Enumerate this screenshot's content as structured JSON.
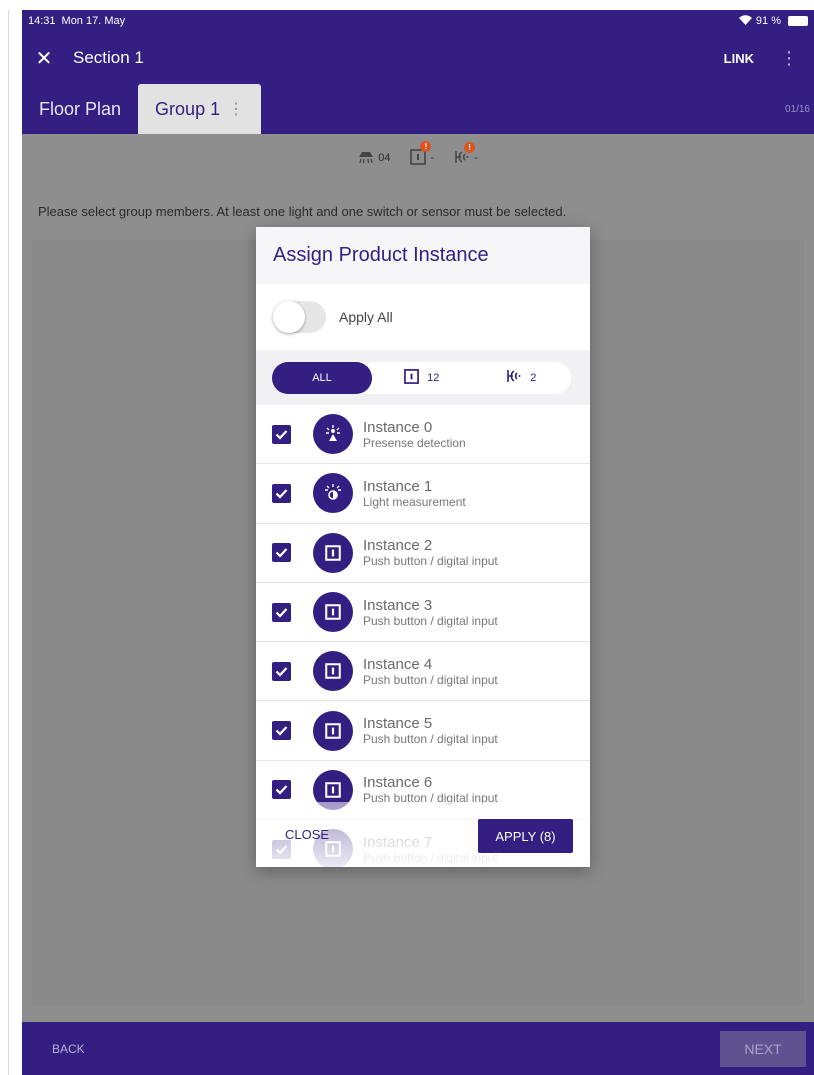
{
  "status_bar": {
    "time": "14:31",
    "date": "Mon 17. May",
    "battery": "91 %"
  },
  "app_bar": {
    "title": "Section 1",
    "link_label": "LINK"
  },
  "tabs": {
    "floor_plan": "Floor Plan",
    "group": "Group 1",
    "pager": "01/16"
  },
  "summary": {
    "lights_count": "04",
    "switches_count": "-",
    "sensors_count": "-",
    "alert_mark": "!"
  },
  "instructions": "Please select group members. At least one light and one switch or sensor must be selected.",
  "dialog": {
    "title": "Assign Product Instance",
    "apply_all_label": "Apply All",
    "apply_all_on": false,
    "filters": {
      "all": "ALL",
      "switch_count": "12",
      "sensor_count": "2"
    },
    "instances": [
      {
        "name": "Instance 0",
        "type": "Presense detection",
        "icon": "presence-sensor-icon",
        "checked": true
      },
      {
        "name": "Instance 1",
        "type": "Light measurement",
        "icon": "light-sensor-icon",
        "checked": true
      },
      {
        "name": "Instance 2",
        "type": "Push button / digital input",
        "icon": "push-button-icon",
        "checked": true
      },
      {
        "name": "Instance 3",
        "type": "Push button / digital input",
        "icon": "push-button-icon",
        "checked": true
      },
      {
        "name": "Instance 4",
        "type": "Push button / digital input",
        "icon": "push-button-icon",
        "checked": true
      },
      {
        "name": "Instance 5",
        "type": "Push button / digital input",
        "icon": "push-button-icon",
        "checked": true
      },
      {
        "name": "Instance 6",
        "type": "Push button / digital input",
        "icon": "push-button-icon",
        "checked": true
      },
      {
        "name": "Instance 7",
        "type": "Push button / digital input",
        "icon": "push-button-icon",
        "checked": true
      }
    ],
    "close_label": "CLOSE",
    "apply_label": "APPLY (8)"
  },
  "bottom_bar": {
    "back_label": "BACK",
    "next_label": "NEXT"
  },
  "colors": {
    "brand": "#331e82",
    "alert": "#d9541e",
    "overlay": "#8e8e8e"
  }
}
